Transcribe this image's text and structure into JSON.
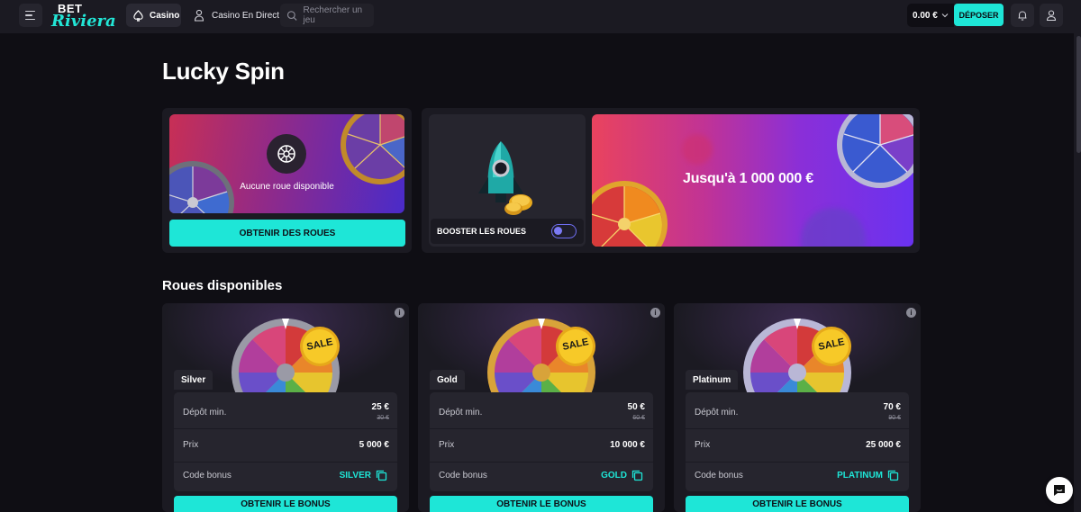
{
  "header": {
    "logo_top": "BET",
    "logo_bottom": "Riviera",
    "nav_casino": "Casino",
    "nav_live": "Casino En Direct",
    "search_placeholder": "Rechercher un jeu",
    "balance": "0.00 €",
    "deposit": "DÉPOSER"
  },
  "page": {
    "title": "Lucky Spin"
  },
  "wheels_panel": {
    "status": "Aucune roue disponible",
    "cta": "OBTENIR DES ROUES"
  },
  "booster": {
    "label": "BOOSTER LES ROUES",
    "enabled": false
  },
  "promo": {
    "text": "Jusqu'à 1 000 000 €"
  },
  "available": {
    "title": "Roues disponibles",
    "cards": [
      {
        "tier": "Silver",
        "badge": "SALE",
        "min_label": "Dépôt min.",
        "min_value": "25 €",
        "min_old": "30 €",
        "price_label": "Prix",
        "price_value": "5 000 €",
        "code_label": "Code bonus",
        "code": "SILVER",
        "cta": "OBTENIR LE BONUS",
        "rim_color": "#9a9aa6"
      },
      {
        "tier": "Gold",
        "badge": "SALE",
        "min_label": "Dépôt min.",
        "min_value": "50 €",
        "min_old": "60 €",
        "price_label": "Prix",
        "price_value": "10 000 €",
        "code_label": "Code bonus",
        "code": "GOLD",
        "cta": "OBTENIR LE BONUS",
        "rim_color": "#d8a33a"
      },
      {
        "tier": "Platinum",
        "badge": "SALE",
        "min_label": "Dépôt min.",
        "min_value": "70 €",
        "min_old": "90 €",
        "price_label": "Prix",
        "price_value": "25 000 €",
        "code_label": "Code bonus",
        "code": "PLATINUM",
        "cta": "OBTENIR LE BONUS",
        "rim_color": "#b9b7d6"
      }
    ]
  },
  "colors": {
    "accent": "#1ee6d7",
    "background": "#0f0e14",
    "card": "#1b1a22"
  }
}
